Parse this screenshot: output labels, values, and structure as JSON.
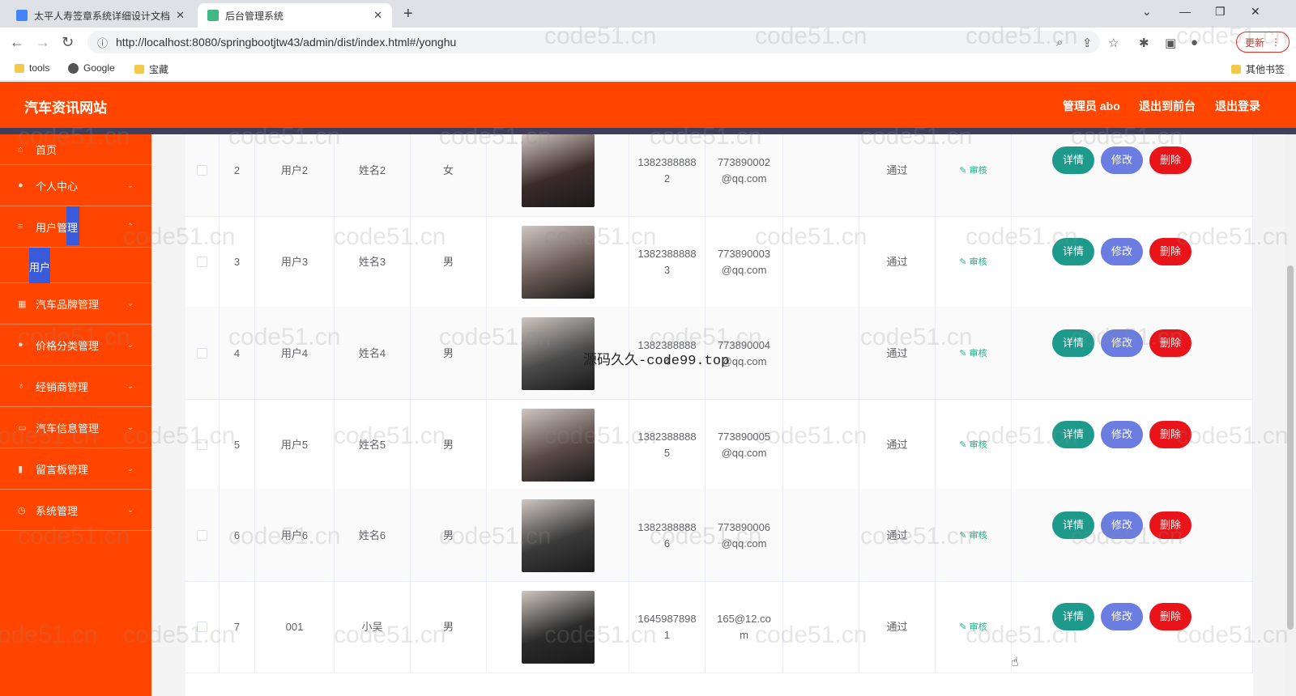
{
  "browser": {
    "tabs": [
      {
        "title": "太平人寿签章系统详细设计文档",
        "active": false,
        "favicon_color": "#4285f4"
      },
      {
        "title": "后台管理系统",
        "active": true,
        "favicon_color": "#41b883"
      }
    ],
    "url": "http://localhost:8080/springbootjtw43/admin/dist/index.html#/yonghu",
    "update_label": "更新",
    "bookmarks": [
      "tools",
      "Google",
      "宝藏"
    ],
    "other_bookmarks": "其他书签"
  },
  "header": {
    "brand": "汽车资讯网站",
    "admin_label": "管理员 abo",
    "exit_front": "退出到前台",
    "logout": "退出登录"
  },
  "sidebar": {
    "items": [
      {
        "label": "首页",
        "icon": "home-icon"
      },
      {
        "label": "个人中心",
        "icon": "user-icon"
      },
      {
        "label": "用户管理",
        "icon": "menu-icon",
        "active": true
      },
      {
        "label": "汽车品牌管理",
        "icon": "grid-icon"
      },
      {
        "label": "价格分类管理",
        "icon": "user-icon"
      },
      {
        "label": "经销商管理",
        "icon": "bulb-icon"
      },
      {
        "label": "汽车信息管理",
        "icon": "chat-icon"
      },
      {
        "label": "留言板管理",
        "icon": "chart-icon"
      },
      {
        "label": "系统管理",
        "icon": "clock-icon"
      }
    ],
    "submenu_label": "用户"
  },
  "table": {
    "rows": [
      {
        "index": "2",
        "account": "用户2",
        "name": "姓名2",
        "gender": "女",
        "phone": [
          "1382388888",
          "2"
        ],
        "email": [
          "773890002",
          "@qq.com"
        ],
        "status": "通过",
        "avatar_color": "#3b2a2a"
      },
      {
        "index": "3",
        "account": "用户3",
        "name": "姓名3",
        "gender": "男",
        "phone": [
          "1382388888",
          "3"
        ],
        "email": [
          "773890003",
          "@qq.com"
        ],
        "status": "通过",
        "avatar_color": "#6a5a55"
      },
      {
        "index": "4",
        "account": "用户4",
        "name": "姓名4",
        "gender": "男",
        "phone": [
          "1382388888",
          "4"
        ],
        "email": [
          "773890004",
          "@qq.com"
        ],
        "status": "通过",
        "avatar_color": "#4a4a4a"
      },
      {
        "index": "5",
        "account": "用户5",
        "name": "姓名5",
        "gender": "男",
        "phone": [
          "1382388888",
          "5"
        ],
        "email": [
          "773890005",
          "@qq.com"
        ],
        "status": "通过",
        "avatar_color": "#5a4a48"
      },
      {
        "index": "6",
        "account": "用户6",
        "name": "姓名6",
        "gender": "男",
        "phone": [
          "1382388888",
          "6"
        ],
        "email": [
          "773890006",
          "@qq.com"
        ],
        "status": "通过",
        "avatar_color": "#3a3a3a"
      },
      {
        "index": "7",
        "account": "001",
        "name": "小吴",
        "gender": "男",
        "phone": [
          "1645987898",
          "1"
        ],
        "email": [
          "165@12.co",
          "m"
        ],
        "status": "通过",
        "avatar_color": "#2a2a2a"
      }
    ],
    "audit_label": "审核",
    "detail_label": "详情",
    "edit_label": "修改",
    "delete_label": "删除"
  },
  "watermark": "code51.cn",
  "overlay_text": "源码久久-code99.top"
}
